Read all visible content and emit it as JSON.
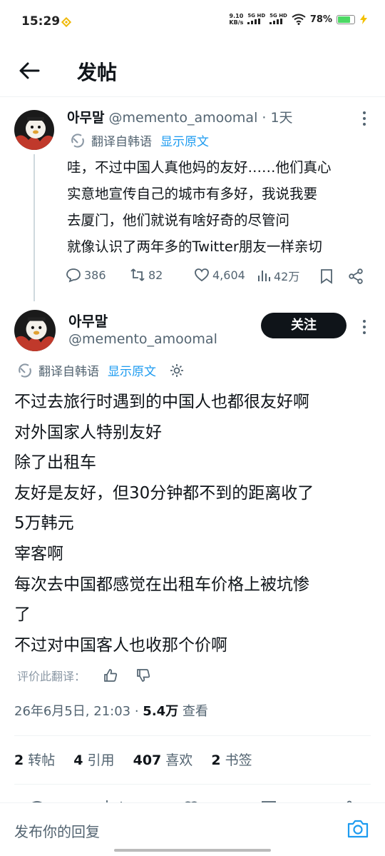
{
  "status_bar": {
    "time": "15:29",
    "net_speed": "9.10",
    "net_speed_unit": "KB/s",
    "net1": "5G HD",
    "net2": "5G HD",
    "battery": "78%"
  },
  "header": {
    "title": "发帖"
  },
  "parent_tweet": {
    "name": "아무말",
    "handle": "@memento_amoomal",
    "time": "· 1天",
    "translate_label": "翻译自韩语",
    "show_original": "显示原文",
    "lines": [
      "哇，不过中国人真他妈的友好……他们真心",
      "实意地宣传自己的城市有多好，我说我要",
      "去厦门，他们就说有啥好奇的尽管问",
      "就像认识了两年多的Twitter朋友一样亲切"
    ],
    "replies": "386",
    "retweets": "82",
    "likes": "4,604",
    "views": "42万"
  },
  "main_tweet": {
    "name": "아무말",
    "handle": "@memento_amoomal",
    "follow_label": "关注",
    "translate_label": "翻译自韩语",
    "show_original": "显示原文",
    "lines": [
      "不过去旅行时遇到的中国人也都很友好啊",
      "对外国家人特别友好",
      "除了出租车",
      "友好是友好，但30分钟都不到的距离收了",
      "5万韩元",
      "宰客啊",
      "每次去中国都感觉在出租车价格上被坑惨",
      "了",
      "不过对中国客人也收那个价啊"
    ],
    "rate_label": "评价此翻译：",
    "timestamp": "26年6月5日, 21:03 · ",
    "views_count": "5.4万",
    "views_label": " 查看",
    "stats": {
      "retweets_count": "2",
      "retweets_label": "转帖",
      "quotes_count": "4",
      "quotes_label": "引用",
      "likes_count": "407",
      "likes_label": "喜欢",
      "bookmarks_count": "2",
      "bookmarks_label": "书签"
    }
  },
  "reply_bar": {
    "placeholder": "发布你的回复"
  },
  "colors": {
    "accent": "#1d9bf0",
    "text": "#0f1419",
    "muted": "#536471"
  }
}
